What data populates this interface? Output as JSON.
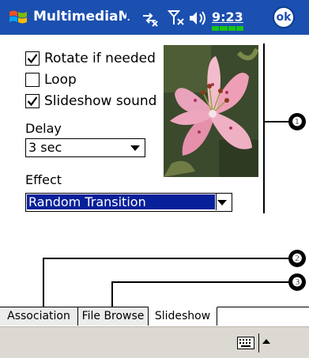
{
  "titlebar": {
    "title": "MultimediaMan",
    "title_overflow": ".",
    "time": "9:23",
    "ok_label": "ok",
    "icons": [
      "windows-start-icon",
      "connectivity-icon",
      "signal-off-icon",
      "speaker-icon",
      "battery-icon"
    ],
    "bar_color": "#1b4fb0"
  },
  "options": {
    "rotate": {
      "label": "Rotate if needed",
      "checked": true
    },
    "loop": {
      "label": "Loop",
      "checked": false
    },
    "slideshow_sound": {
      "label": "Slideshow sound",
      "checked": true
    }
  },
  "delay": {
    "label": "Delay",
    "value": "3 sec"
  },
  "effect": {
    "label": "Effect",
    "value": "Random Transition",
    "highlight_color": "#08209a"
  },
  "preview": {
    "subject": "pink lily flower photo"
  },
  "callouts": [
    "❶",
    "❷",
    "❸"
  ],
  "tabs": [
    {
      "label": "Association",
      "active": false
    },
    {
      "label": "File Browse",
      "active": false
    },
    {
      "label": "Slideshow",
      "active": true
    }
  ],
  "menubar": {
    "icons": [
      "keyboard-icon",
      "input-menu-arrow-icon"
    ]
  }
}
